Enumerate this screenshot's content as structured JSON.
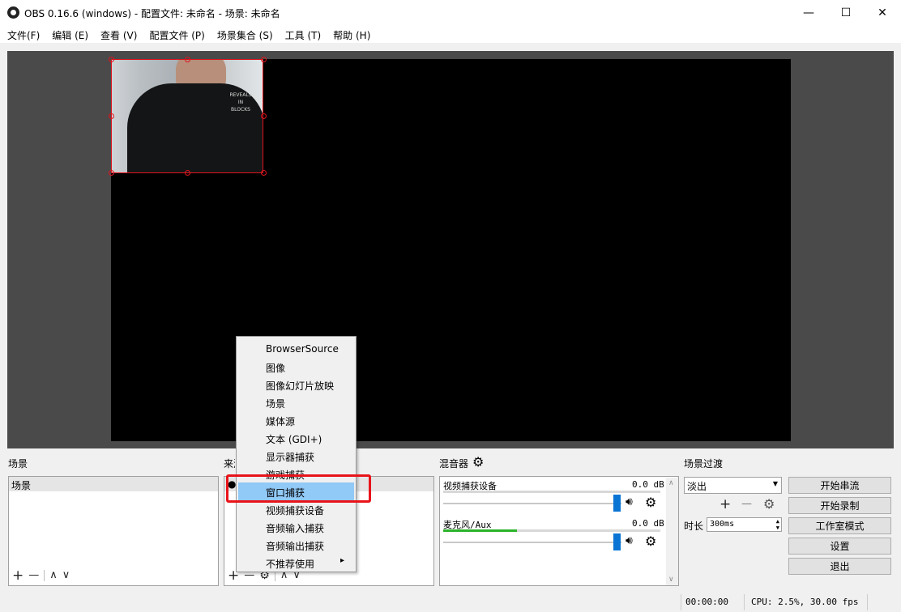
{
  "window": {
    "title": "OBS 0.16.6 (windows) - 配置文件: 未命名 - 场景: 未命名",
    "minimize": "—",
    "maximize": "☐",
    "close": "✕"
  },
  "menu": [
    "文件(F)",
    "编辑 (E)",
    "查看 (V)",
    "配置文件 (P)",
    "场景集合 (S)",
    "工具 (T)",
    "帮助 (H)"
  ],
  "preview": {
    "shirt_print": [
      "REVEALS",
      "IN",
      "BLOCKS"
    ]
  },
  "scenes": {
    "title": "场景",
    "items": [
      "场景"
    ],
    "add": "+",
    "remove": "—",
    "up": "∧",
    "down": "∨"
  },
  "sources": {
    "title": "来源",
    "add": "+",
    "remove": "—",
    "up": "∧",
    "down": "∨"
  },
  "mixer": {
    "title": "混音器",
    "channels": [
      {
        "name": "视频捕获设备",
        "db": "0.0 dB",
        "level": 0.0,
        "volume": 1.0
      },
      {
        "name": "麦克风/Aux",
        "db": "0.0 dB",
        "level": 0.34,
        "volume": 1.0
      }
    ]
  },
  "transition": {
    "title": "场景过渡",
    "selected": "淡出",
    "add": "+",
    "remove": "—",
    "duration_label": "时长",
    "duration_value": "300ms"
  },
  "controls": {
    "start_stream": "开始串流",
    "start_record": "开始录制",
    "studio_mode": "工作室模式",
    "settings": "设置",
    "exit": "退出"
  },
  "context_menu": {
    "items": [
      "BrowserSource",
      "图像",
      "图像幻灯片放映",
      "场景",
      "媒体源",
      "文本 (GDI+)",
      "显示器捕获",
      "游戏捕获",
      "窗口捕获",
      "视频捕获设备",
      "音频输入捕获",
      "音频输出捕获",
      "不推荐使用"
    ],
    "highlighted_index": 8,
    "submenu_arrow": "▸"
  },
  "status": {
    "time": "00:00:00",
    "cpu": "CPU: 2.5%, 30.00 fps"
  },
  "colors": {
    "accent": "#0a74d4",
    "selection": "#e0141e",
    "menu_highlight": "#91c9f7",
    "meter_green": "#2bb32b"
  }
}
